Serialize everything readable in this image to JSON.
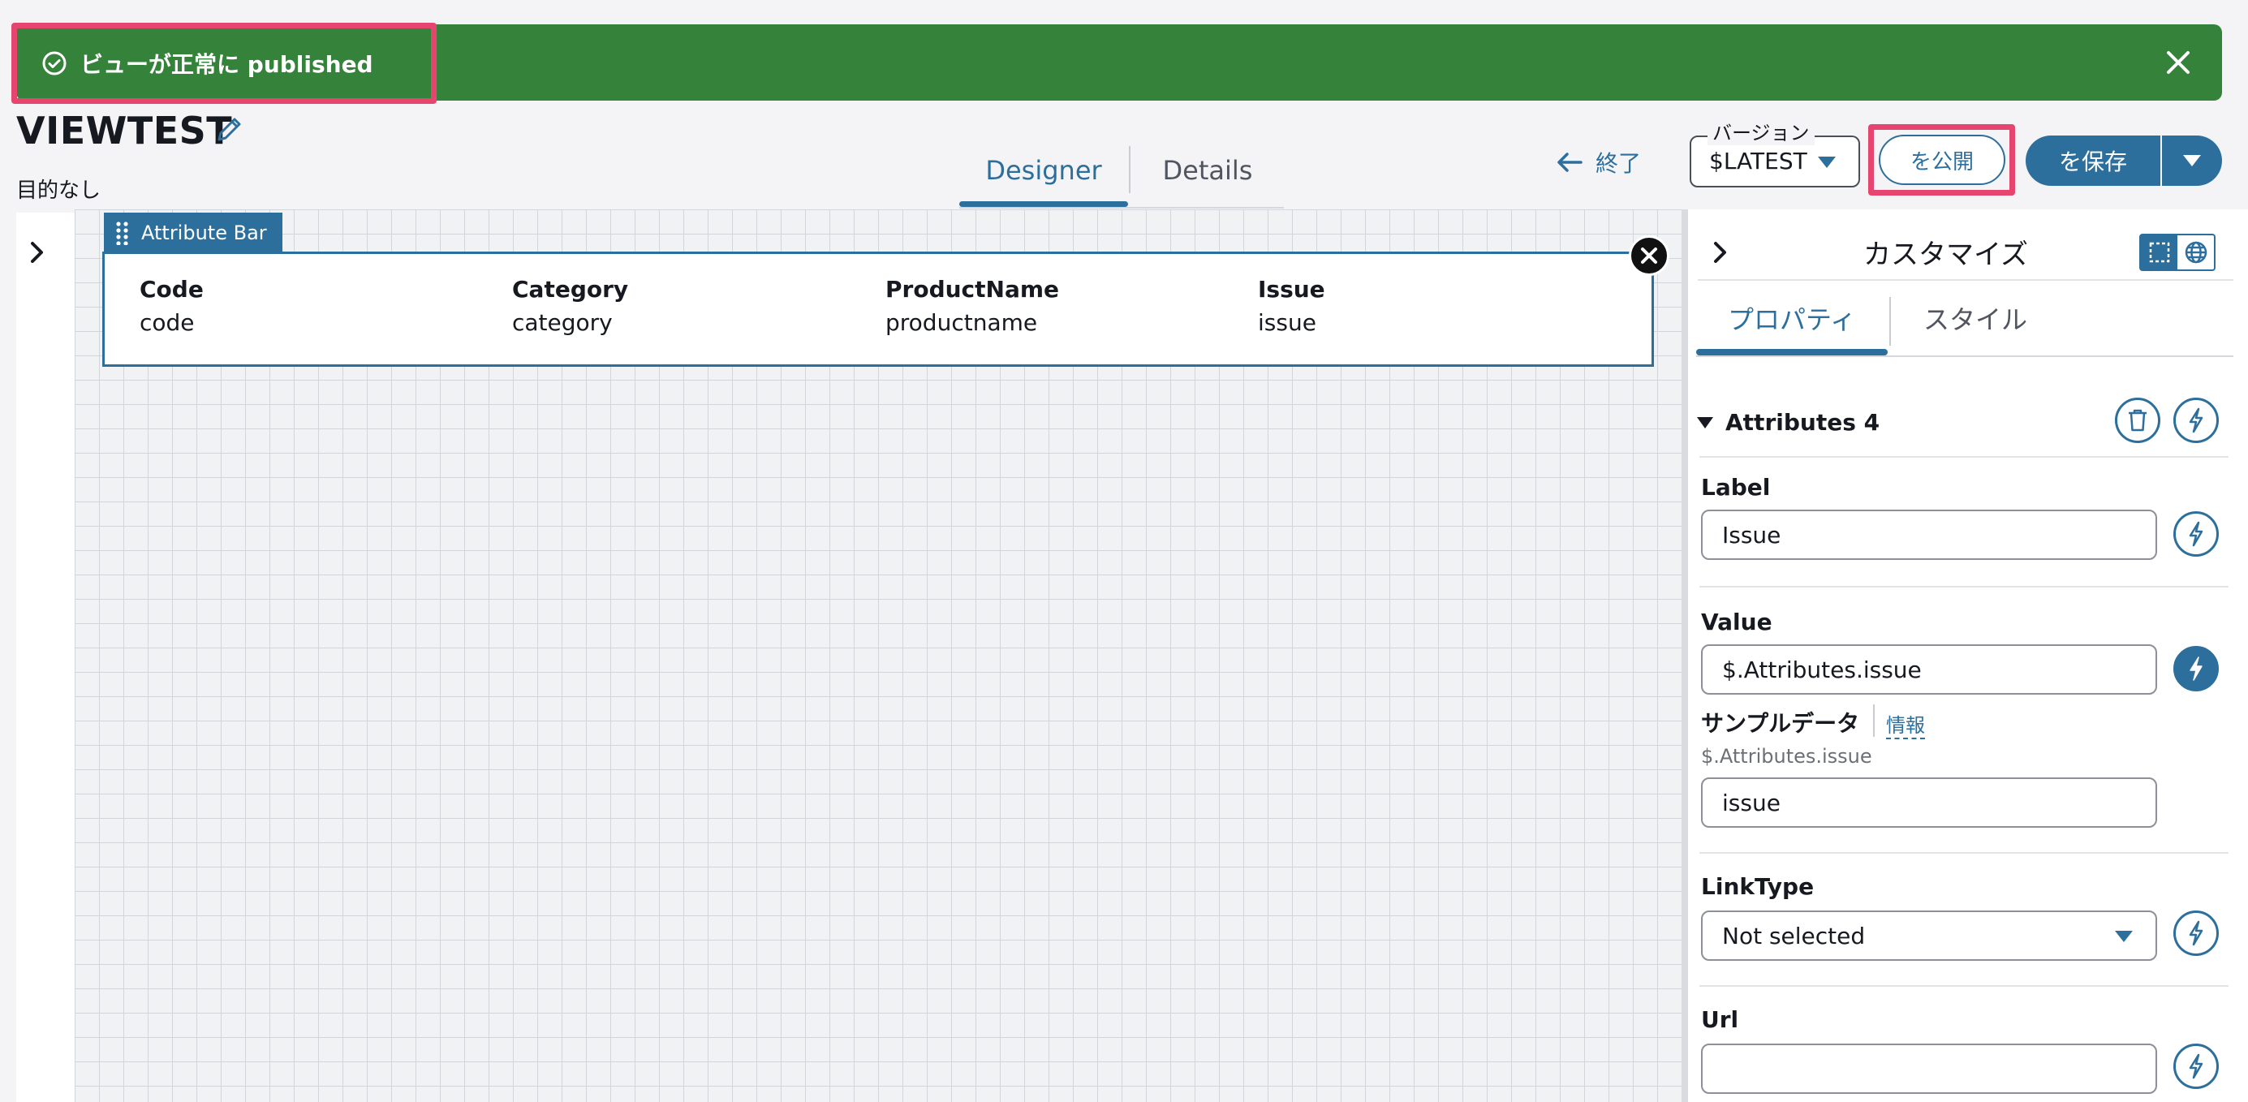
{
  "banner": {
    "message": "ビューが正常に published",
    "bg_color": "#35823a",
    "highlight_color": "#e6456f"
  },
  "header": {
    "title": "VIEWTEST",
    "description": "目的なし",
    "tabs": [
      {
        "label": "Designer",
        "active": true
      },
      {
        "label": "Details",
        "active": false
      }
    ],
    "exit_label": "終了",
    "version": {
      "legend": "バージョン",
      "value": "$LATEST"
    },
    "publish_label": "を公開",
    "save_label": "を保存"
  },
  "canvas": {
    "widget": {
      "name": "Attribute Bar",
      "attributes": [
        {
          "header": "Code",
          "value": "code"
        },
        {
          "header": "Category",
          "value": "category"
        },
        {
          "header": "ProductName",
          "value": "productname"
        },
        {
          "header": "Issue",
          "value": "issue"
        }
      ]
    }
  },
  "panel": {
    "title": "カスタマイズ",
    "tabs": [
      {
        "label": "プロパティ",
        "active": true
      },
      {
        "label": "スタイル",
        "active": false
      }
    ],
    "section": "Attributes 4",
    "fields": {
      "label": {
        "label": "Label",
        "value": "Issue"
      },
      "value": {
        "label": "Value",
        "value": "$.Attributes.issue"
      },
      "sample": {
        "label": "サンプルデータ",
        "info": "情報",
        "path": "$.Attributes.issue",
        "value": "issue"
      },
      "linktype": {
        "label": "LinkType",
        "value": "Not selected"
      },
      "url": {
        "label": "Url",
        "value": ""
      }
    }
  },
  "colors": {
    "accent": "#2d6f9c",
    "banner": "#35823a",
    "highlight": "#e6456f"
  }
}
